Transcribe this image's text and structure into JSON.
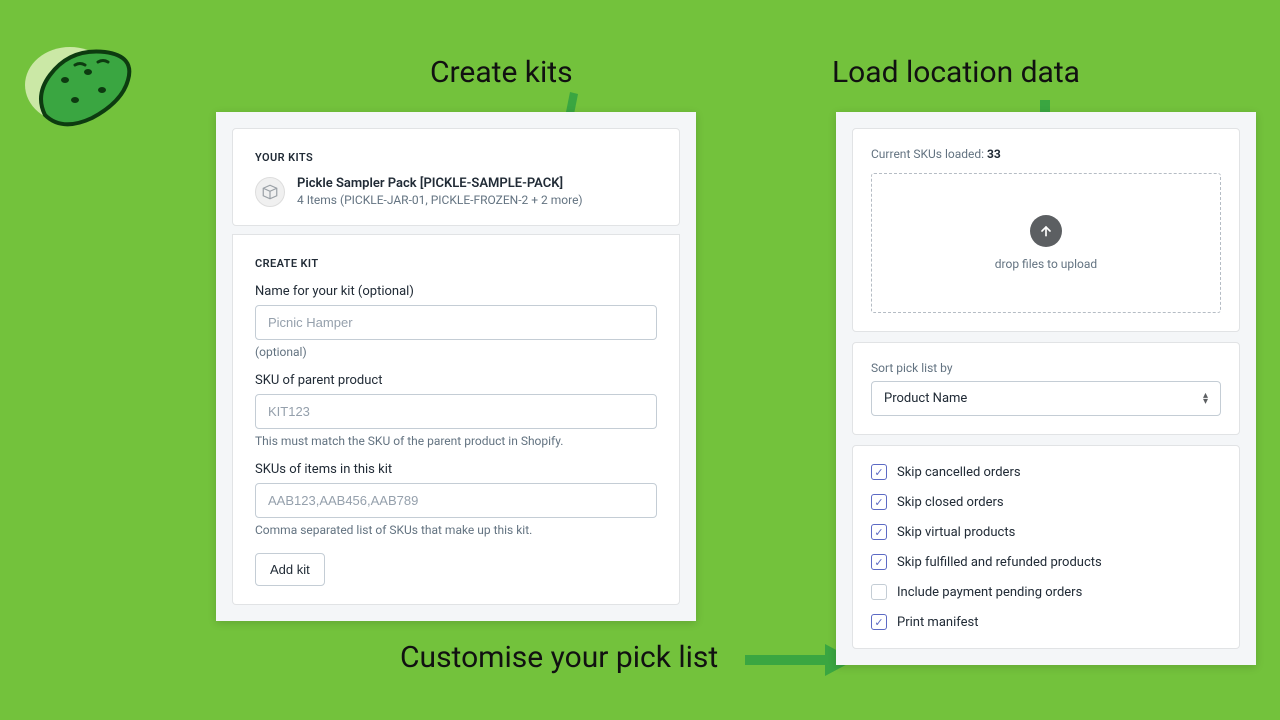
{
  "annotations": {
    "create_kits": "Create kits",
    "load_location": "Load location data",
    "customise": "Customise your pick list"
  },
  "kits_panel": {
    "heading": "YOUR KITS",
    "kit_title": "Pickle Sampler Pack [PICKLE-SAMPLE-PACK]",
    "kit_subtitle": "4 Items (PICKLE-JAR-01, PICKLE-FROZEN-2 + 2 more)",
    "create_heading": "CREATE KIT",
    "name_label": "Name for your kit (optional)",
    "name_placeholder": "Picnic Hamper",
    "name_help": "(optional)",
    "sku_label": "SKU of parent product",
    "sku_placeholder": "KIT123",
    "sku_help": "This must match the SKU of the parent product in Shopify.",
    "items_label": "SKUs of items in this kit",
    "items_placeholder": "AAB123,AAB456,AAB789",
    "items_help": "Comma separated list of SKUs that make up this kit.",
    "add_button": "Add kit"
  },
  "location_panel": {
    "loaded_prefix": "Current SKUs loaded: ",
    "loaded_count": "33",
    "drop_label": "drop files to upload",
    "sort_label": "Sort pick list by",
    "sort_value": "Product Name",
    "checks": [
      {
        "label": "Skip cancelled orders",
        "checked": true
      },
      {
        "label": "Skip closed orders",
        "checked": true
      },
      {
        "label": "Skip virtual products",
        "checked": true
      },
      {
        "label": "Skip fulfilled and refunded products",
        "checked": true
      },
      {
        "label": "Include payment pending orders",
        "checked": false
      },
      {
        "label": "Print manifest",
        "checked": true
      }
    ]
  }
}
